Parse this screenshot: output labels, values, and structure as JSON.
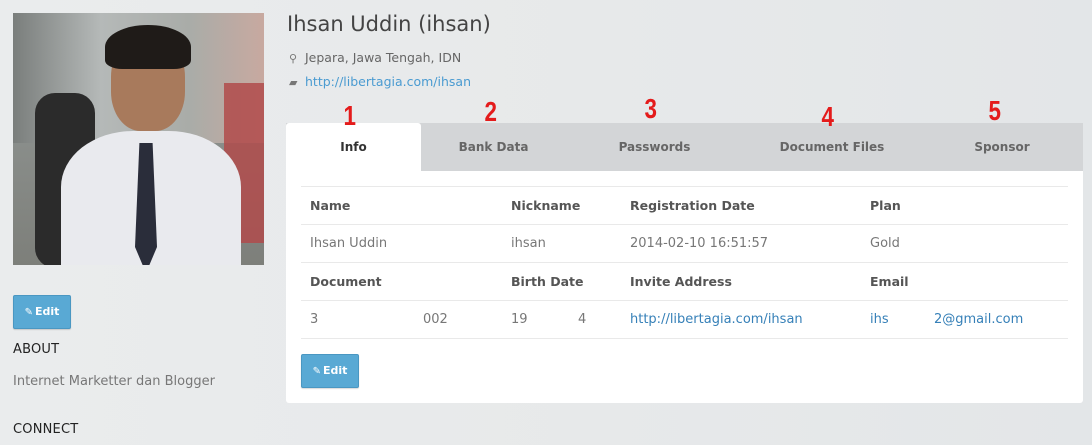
{
  "profile": {
    "name": "Ihsan Uddin (ihsan)",
    "location": "Jepara, Jawa Tengah, IDN",
    "website": "http://libertagia.com/ihsan"
  },
  "sidebar": {
    "edit_label": "Edit",
    "about_heading": "ABOUT",
    "about_text": "Internet Marketter dan Blogger",
    "connect_heading": "CONNECT"
  },
  "tabs": [
    {
      "label": "Info",
      "marker": "1",
      "active": true
    },
    {
      "label": "Bank Data",
      "marker": "2",
      "active": false
    },
    {
      "label": "Passwords",
      "marker": "3",
      "active": false
    },
    {
      "label": "Document Files",
      "marker": "4",
      "active": false
    },
    {
      "label": "Sponsor",
      "marker": "5",
      "active": false
    }
  ],
  "info": {
    "headers1": {
      "name": "Name",
      "nickname": "Nickname",
      "registration_date": "Registration Date",
      "plan": "Plan"
    },
    "values1": {
      "name": "Ihsan Uddin",
      "nickname": "ihsan",
      "registration_date": "2014-02-10 16:51:57",
      "plan": "Gold"
    },
    "headers2": {
      "document": "Document",
      "birth_date": "Birth Date",
      "invite_address": "Invite Address",
      "email": "Email"
    },
    "values2": {
      "document_a": "3",
      "document_b": "002",
      "birth_a": "19",
      "birth_b": "4",
      "invite_address": "http://libertagia.com/ihsan",
      "email_a": "ihs",
      "email_b": "2@gmail.com"
    },
    "edit_label": "Edit"
  },
  "colors": {
    "accent": "#59a9d4",
    "marker": "#e41b1b",
    "link": "#3680b8"
  },
  "icons": {
    "location": "map-marker-icon",
    "website": "briefcase-icon",
    "edit": "pencil-square-icon"
  }
}
